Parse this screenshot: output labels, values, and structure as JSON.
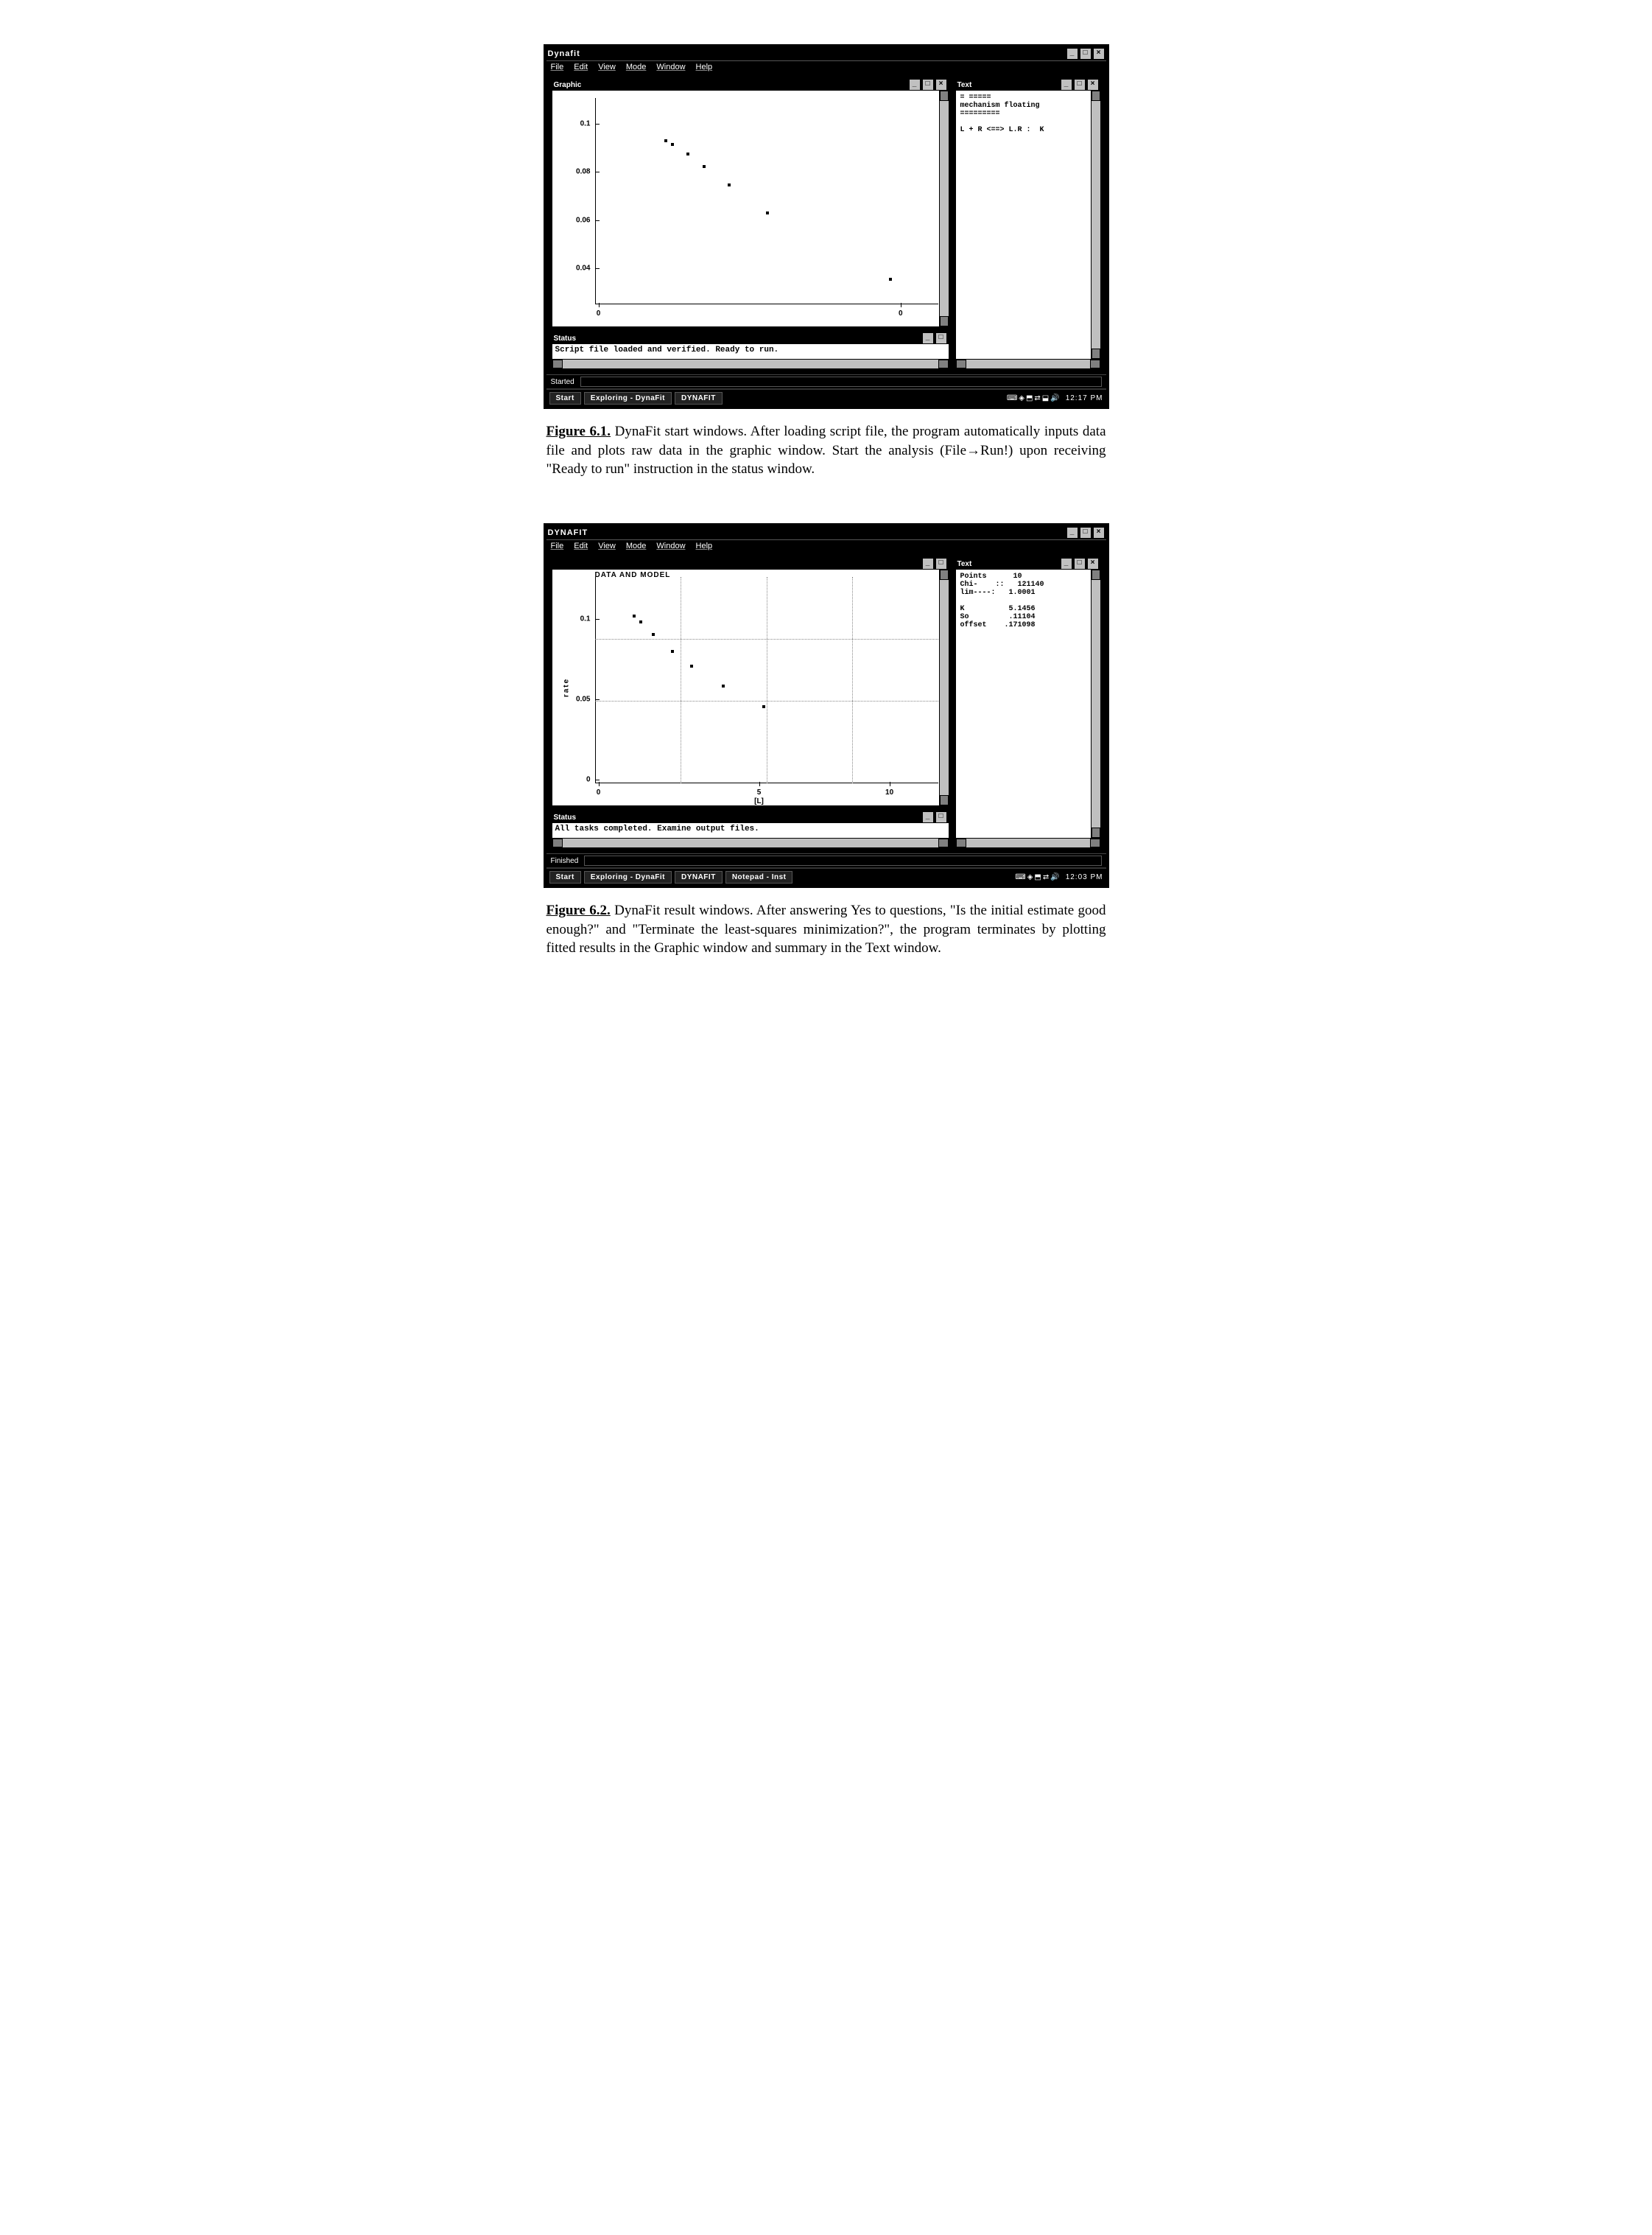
{
  "figure1": {
    "app_title": "Dynafit",
    "menu": [
      "File",
      "Edit",
      "View",
      "Mode",
      "Window",
      "Help"
    ],
    "graphic_title": "Graphic",
    "text_title": "Text",
    "status_title": "Status",
    "status_text": "Script file loaded and verified. Ready to run.",
    "text_panel_lines": [
      "= =====",
      "mechanism floating",
      "=========",
      "",
      "L + R <==> L.R :  K"
    ],
    "progress_label": "Started",
    "taskbar": {
      "start": "Start",
      "items": [
        "Exploring - DynaFit",
        "DYNAFIT"
      ],
      "tray_icons": "⌨◈⬒⇄⬓🔊",
      "clock": "12:17 PM"
    },
    "chart_data": {
      "type": "scatter",
      "title": "",
      "xlabel": "",
      "ylabel": "",
      "yticks": [
        "0.1",
        "0.08",
        "0.06",
        "0.04"
      ],
      "xticks": [
        "0",
        "0"
      ],
      "points_pct": [
        {
          "x": 22,
          "y": 88
        },
        {
          "x": 24,
          "y": 86
        },
        {
          "x": 29,
          "y": 81
        },
        {
          "x": 34,
          "y": 74
        },
        {
          "x": 42,
          "y": 64
        },
        {
          "x": 54,
          "y": 49
        },
        {
          "x": 93,
          "y": 13
        }
      ]
    },
    "caption_lead": "Figure 6.1.",
    "caption_body": "DynaFit start windows. After loading script file, the program automatically inputs data file and plots raw data in the graphic window. Start the analysis (File→Run!) upon receiving \"Ready to run\" instruction in the status window."
  },
  "figure2": {
    "app_title": "DYNAFIT",
    "menu": [
      "File",
      "Edit",
      "View",
      "Mode",
      "Window",
      "Help"
    ],
    "graphic_title": "",
    "plot_title": "DATA AND MODEL",
    "text_title": "Text",
    "status_title": "Status",
    "status_text": "All tasks completed. Examine output files.",
    "text_panel_rows": [
      {
        "label": "Points",
        "value": "10"
      },
      {
        "label": "Chi-    ::",
        "value": "121140"
      },
      {
        "label": "lim----:",
        "value": "1.0001"
      },
      {
        "label": "",
        "value": ""
      },
      {
        "label": "K",
        "value": "5.1456"
      },
      {
        "label": "So",
        "value": ".11104"
      },
      {
        "label": "offset",
        "value": ".171098"
      }
    ],
    "progress_label": "Finished",
    "taskbar": {
      "start": "Start",
      "items": [
        "Exploring - DynaFit",
        "DYNAFIT",
        "Notepad - Inst"
      ],
      "tray_icons": "⌨◈⬒⇄🔊",
      "clock": "12:03 PM"
    },
    "chart_data": {
      "type": "scatter",
      "title": "DATA AND MODEL",
      "xlabel": "[L]",
      "ylabel": "rate",
      "yticks": [
        "0.1",
        "0.05",
        "0"
      ],
      "xticks": [
        "0",
        "5",
        "10"
      ],
      "points_pct": [
        {
          "x": 12,
          "y": 90
        },
        {
          "x": 14,
          "y": 87
        },
        {
          "x": 18,
          "y": 80
        },
        {
          "x": 24,
          "y": 71
        },
        {
          "x": 30,
          "y": 63
        },
        {
          "x": 40,
          "y": 52
        },
        {
          "x": 53,
          "y": 41
        }
      ]
    },
    "caption_lead": "Figure 6.2.",
    "caption_body": "DynaFit result windows. After answering Yes to questions, \"Is the initial estimate good enough?\" and \"Terminate the least-squares minimization?\", the program terminates by plotting fitted results in the Graphic window and summary in the Text window."
  }
}
